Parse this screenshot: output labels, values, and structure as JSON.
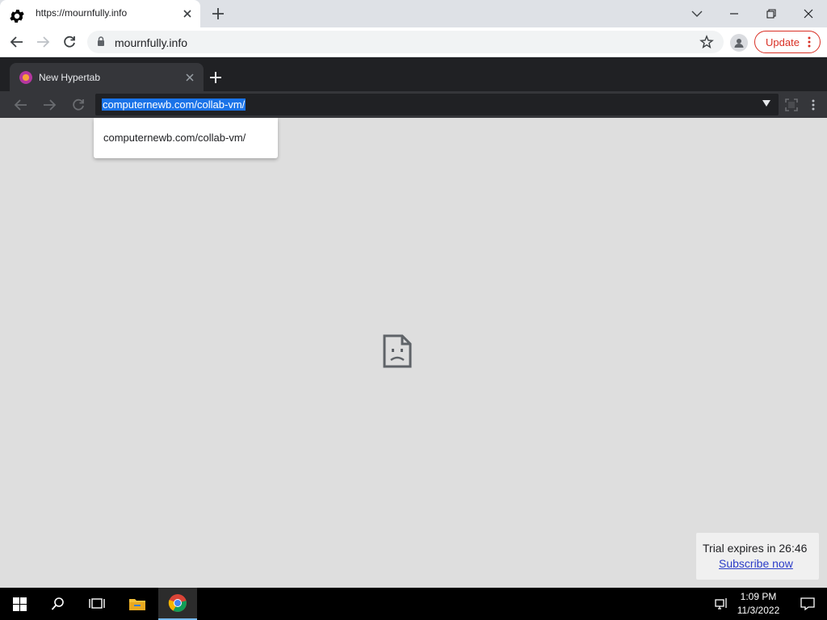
{
  "outer_browser": {
    "tab_title": "https://mournfully.info",
    "url": "mournfully.info",
    "update_label": "Update"
  },
  "hypertab": {
    "tab_title": "New Hypertab",
    "address_value": "computernewb.com/collab-vm/",
    "suggestion": "computernewb.com/collab-vm/"
  },
  "trial": {
    "text": "Trial expires in 26:46",
    "link": "Subscribe now"
  },
  "taskbar": {
    "time": "1:09 PM",
    "date": "11/3/2022"
  },
  "colors": {
    "update_red": "#d93025",
    "selection_blue": "#1a73e8",
    "dark_chrome": "#202124",
    "link_blue": "#2b3cc8"
  }
}
